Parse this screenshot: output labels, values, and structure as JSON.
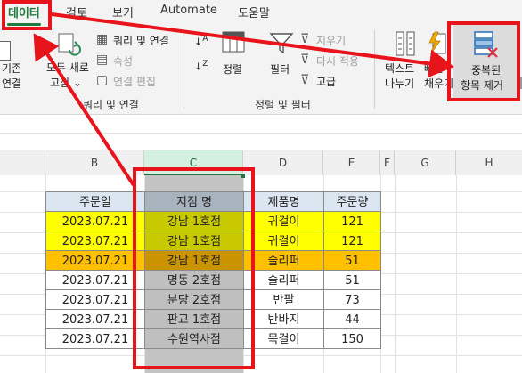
{
  "tabs": {
    "data": "데이터",
    "review": "검토",
    "view": "보기",
    "automate": "Automate",
    "help": "도움말"
  },
  "ribbon": {
    "existing_connections": [
      "기존",
      "연결"
    ],
    "refresh_all": [
      "모두 새로",
      "고침"
    ],
    "queries_connections": "쿼리 및 연결",
    "properties": "속성",
    "edit_links": "연결 편집",
    "group_queries": "쿼리 및 연결",
    "sort": "정렬",
    "filter": "필터",
    "clear": "지우기",
    "reapply": "다시 적용",
    "advanced": "고급",
    "group_sort_filter": "정렬 및 필터",
    "text_to_columns": [
      "텍스트",
      "나누기"
    ],
    "flash_fill": [
      "빠른",
      "채우기"
    ],
    "remove_duplicates": [
      "중복된",
      "항목 제거"
    ]
  },
  "columns": [
    "B",
    "C",
    "D",
    "E",
    "F",
    "G",
    "H"
  ],
  "table": {
    "headers": [
      "주문일",
      "지점 명",
      "제품명",
      "주문량"
    ],
    "rows": [
      {
        "date": "2023.07.21",
        "branch": "강남 1호점",
        "product": "귀걸이",
        "qty": "121"
      },
      {
        "date": "2023.07.21",
        "branch": "강남 1호점",
        "product": "귀걸이",
        "qty": "121"
      },
      {
        "date": "2023.07.21",
        "branch": "강남 1호점",
        "product": "슬리퍼",
        "qty": "51"
      },
      {
        "date": "2023.07.21",
        "branch": "명동 2호점",
        "product": "슬리퍼",
        "qty": "51"
      },
      {
        "date": "2023.07.21",
        "branch": "분당 2호점",
        "product": "반팔",
        "qty": "73"
      },
      {
        "date": "2023.07.21",
        "branch": "판교 1호점",
        "product": "반바지",
        "qty": "44"
      },
      {
        "date": "2023.07.21",
        "branch": "수원역사점",
        "product": "목걸이",
        "qty": "150"
      }
    ]
  },
  "colors": {
    "highlight_yellow": "#ffff00",
    "highlight_yellow_dark": "#c9c900",
    "highlight_orange": "#ffc000",
    "highlight_orange_dark": "#c99400",
    "selection_gray": "#bfbfbf",
    "header_blue": "#dce6f1",
    "annotation_red": "#e8141c",
    "excel_green": "#217346"
  },
  "icons": [
    "refresh-icon",
    "connections-icon",
    "properties-icon",
    "edit-links-icon",
    "sort-icon",
    "filter-icon",
    "clear-filter-icon",
    "reapply-icon",
    "advanced-filter-icon",
    "text-to-columns-icon",
    "flash-fill-icon",
    "remove-duplicates-icon"
  ]
}
